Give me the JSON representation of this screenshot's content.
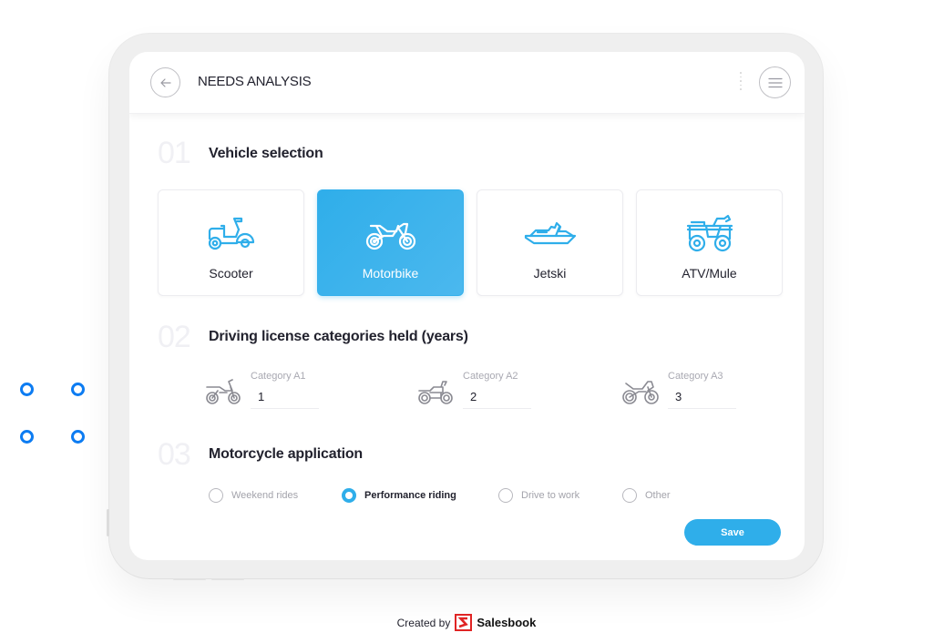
{
  "app": {
    "title": "NEEDS ANALYSIS",
    "accent_color": "#2faeea",
    "decor_dot_color": "#0d7cf2"
  },
  "header": {
    "back_icon": "arrow-left-icon",
    "menu_icon": "hamburger-menu-icon"
  },
  "sections": [
    {
      "number": "01",
      "title": "Vehicle selection"
    },
    {
      "number": "02",
      "title": "Driving license categories held (years)"
    },
    {
      "number": "03",
      "title": "Motorcycle application"
    }
  ],
  "vehicles": [
    {
      "label": "Scooter",
      "icon": "scooter-icon",
      "selected": false
    },
    {
      "label": "Motorbike",
      "icon": "motorbike-icon",
      "selected": true
    },
    {
      "label": "Jetski",
      "icon": "jetski-icon",
      "selected": false
    },
    {
      "label": "ATV/Mule",
      "icon": "atv-icon",
      "selected": false
    }
  ],
  "licenses": [
    {
      "label": "Category A1",
      "value": "1",
      "icon": "dirt-bike-icon"
    },
    {
      "label": "Category A2",
      "value": "2",
      "icon": "classic-motorcycle-icon"
    },
    {
      "label": "Category A3",
      "value": "3",
      "icon": "sport-motorcycle-icon"
    }
  ],
  "applications": [
    {
      "label": "Weekend rides",
      "checked": false
    },
    {
      "label": "Performance riding",
      "checked": true
    },
    {
      "label": "Drive to work",
      "checked": false
    },
    {
      "label": "Other",
      "checked": false
    }
  ],
  "actions": {
    "save_label": "Save"
  },
  "footer": {
    "created_by": "Created by",
    "brand": "Salesbook",
    "logo_color": "#e02424"
  }
}
